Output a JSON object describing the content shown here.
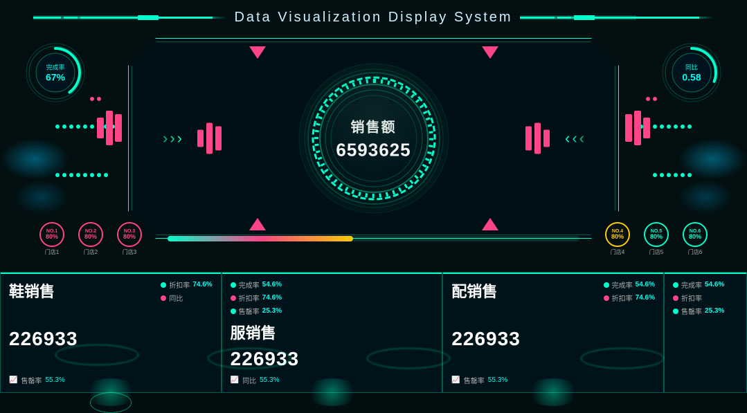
{
  "header": {
    "title": "Data Visualization Display System"
  },
  "gauges": {
    "left": {
      "label": "完成率",
      "value": "67%",
      "percent": 67,
      "color": "#00ffcc"
    },
    "right": {
      "label": "同比",
      "value": "0.58",
      "percent": 58,
      "color": "#00ffcc"
    }
  },
  "center": {
    "sales_label": "销售额",
    "sales_value": "6593625"
  },
  "stores": [
    {
      "no": "NO.1",
      "pct": "80%",
      "name": "门店1",
      "color": "pink"
    },
    {
      "no": "NO.2",
      "pct": "80%",
      "name": "门店2",
      "color": "pink"
    },
    {
      "no": "NO.3",
      "pct": "80%",
      "name": "门店3",
      "color": "pink"
    },
    {
      "no": "NO.4",
      "pct": "80%",
      "name": "门店4",
      "color": "yellow"
    },
    {
      "no": "NO.5",
      "pct": "80%",
      "name": "门店5",
      "color": "cyan"
    },
    {
      "no": "NO.6",
      "pct": "80%",
      "name": "门店6",
      "color": "cyan"
    }
  ],
  "products": [
    {
      "title": "鞋销售",
      "big_number": "226933",
      "stats": [
        {
          "label": "折扣率",
          "value": "74.6%",
          "dot": "cyan"
        },
        {
          "label": "同比",
          "value": "",
          "dot": "pink"
        },
        {
          "label": "售罄率",
          "value": "55.3%",
          "dot": "cyan",
          "is_trend": true
        }
      ]
    },
    {
      "title": "服销售",
      "big_number": "226933",
      "stats": [
        {
          "label": "完成率",
          "value": "54.6%",
          "dot": "cyan"
        },
        {
          "label": "折扣率",
          "value": "74.6%",
          "dot": "pink"
        },
        {
          "label": "同比",
          "value": "55.3%",
          "dot": "cyan",
          "is_trend": true
        }
      ]
    },
    {
      "title": "配销售",
      "big_number": "226933",
      "stats": [
        {
          "label": "完成率",
          "value": "54.6%",
          "dot": "cyan"
        },
        {
          "label": "折扣率",
          "value": "74.6%",
          "dot": "pink"
        },
        {
          "label": "售罄率",
          "value": "55.3%",
          "dot": "cyan",
          "is_trend": true
        }
      ]
    },
    {
      "title": "",
      "big_number": "",
      "stats": [
        {
          "label": "完成率",
          "value": "54.6%",
          "dot": "cyan"
        },
        {
          "label": "折扣率",
          "value": "",
          "dot": "pink"
        },
        {
          "label": "售罄率",
          "value": "25.3%",
          "dot": "cyan",
          "is_trend": true
        }
      ]
    }
  ],
  "progress": {
    "fill_percent": 45
  },
  "colors": {
    "cyan": "#00ffcc",
    "pink": "#ff4488",
    "yellow": "#ffcc00",
    "bg": "#020e10",
    "panel_bg": "rgba(0,20,30,0.7)"
  }
}
